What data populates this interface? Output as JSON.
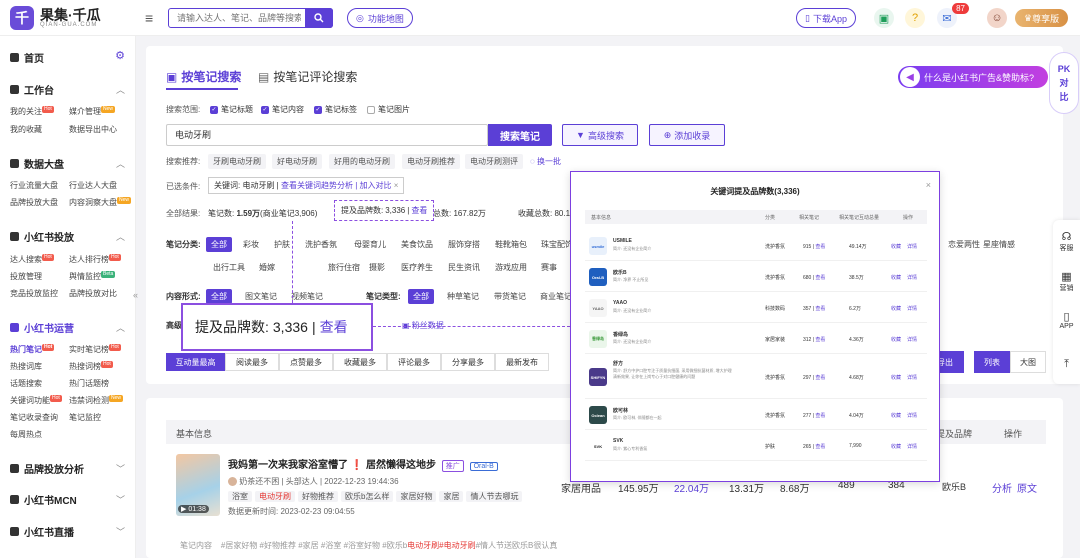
{
  "topbar": {
    "logo_char": "千",
    "logo_name": "果集·千瓜",
    "logo_sub": "QIAN-GUA.COM",
    "search_placeholder": "请输入达人、笔记、品牌等搜索",
    "func_map": "功能地图",
    "download_app": "下载App",
    "mail_count": "87",
    "vip": "尊享版"
  },
  "sidebar": {
    "home": "首页",
    "workbench": "工作台",
    "wb_items": [
      "我的关注",
      "媒介管理",
      "我的收藏",
      "数据导出中心"
    ],
    "dashboard": "数据大盘",
    "db_items": [
      "行业流量大盘",
      "行业达人大盘",
      "品牌投放大盘",
      "内容洞察大盘"
    ],
    "xhs_ad": "小红书投放",
    "ad_items": [
      "达人搜索",
      "达人排行榜",
      "投放管理",
      "舆情监控",
      "竞品投放监控",
      "品牌投放对比"
    ],
    "xhs_ops": "小红书运营",
    "ops_items": [
      "热门笔记",
      "实时笔记榜",
      "热搜词库",
      "热搜词榜",
      "话题搜索",
      "热门话题榜",
      "关键词功能",
      "违禁词检测",
      "笔记收录查询",
      "笔记监控",
      "每周热点"
    ],
    "brand_analysis": "品牌投放分析",
    "mcn": "小红书MCN",
    "live": "小红书直播",
    "tags": {
      "hot": "Hot",
      "new": "New",
      "beta": "Beta"
    }
  },
  "main": {
    "tab_active": "按笔记搜索",
    "tab_other": "按笔记评论搜索",
    "ad_banner": "什么是小红书广告&赞助标?",
    "scope_label": "搜索范围:",
    "scope": [
      {
        "label": "笔记标题",
        "on": true
      },
      {
        "label": "笔记内容",
        "on": true
      },
      {
        "label": "笔记标签",
        "on": true
      },
      {
        "label": "笔记图片",
        "on": false
      }
    ],
    "query": "电动牙刷",
    "search_btn": "搜索笔记",
    "advanced_btn": "高级搜索",
    "add_btn": "添加收录",
    "rec_label": "搜索推荐:",
    "rec": [
      "牙刷电动牙刷",
      "好电动牙刷",
      "好用的电动牙刷",
      "电动牙刷推荐",
      "电动牙刷测评"
    ],
    "refresh": "换一批",
    "cond_label": "已选条件:",
    "cond_tag": "关键词: 电动牙刷",
    "cond_link": "查看关键词趋势分析 | 加入对比",
    "result_label": "全部结果:",
    "result_prefix": "笔记数:",
    "result_count": "1.59万",
    "result_biz": "(商业笔记3,906)",
    "brand_mentions_label": "提及品牌数:",
    "brand_mentions": "3,336",
    "view": "查看",
    "likes": "点赞总数: 167.82万",
    "collects": "收藏总数: 80.11",
    "cat_label": "笔记分类:",
    "cats_row1": [
      "全部",
      "彩妆",
      "护肤",
      "洗护香氛",
      "母婴育儿",
      "美食饮品",
      "服饰穿搭",
      "鞋靴箱包",
      "珠宝配饰"
    ],
    "cats_row1_right": [
      "家居家装",
      "恋爱两性",
      "星座情感"
    ],
    "cats_row2": [
      "出行工具",
      "婚嫁",
      "摄影",
      "旅行住宿",
      "摄影",
      "医疗养生",
      "民生资讯",
      "游戏应用",
      "赛事"
    ],
    "form_label": "内容形式:",
    "forms": [
      "全部",
      "图文笔记",
      "视频笔记"
    ],
    "type_label": "笔记类型:",
    "types": [
      "全部",
      "种草笔记",
      "带货笔记",
      "商业笔记"
    ],
    "adv_label": "高级",
    "fans": "粉丝数据",
    "sort": [
      "互动量最高",
      "阅读最多",
      "点赞最多",
      "收藏最多",
      "评论最多",
      "分享最多",
      "最新发布"
    ],
    "export": "导出",
    "view_list": "列表",
    "view_grid": "大图"
  },
  "floating": {
    "pk": [
      "PK",
      "对",
      "比"
    ],
    "items": [
      "客服",
      "营销",
      "APP"
    ]
  },
  "modal": {
    "title": "关键词提及品牌数(3,336)",
    "headers": [
      "基本信息",
      "分类",
      "相关笔记",
      "相关笔记互动总量",
      "操作"
    ],
    "rows": [
      {
        "logo": "usmile",
        "color": "#e8f0fb",
        "text_color": "#2f6bd6",
        "name": "USMILE",
        "desc": "简介: 还没有企业简介",
        "cat": "洗护香氛",
        "notes": "915",
        "view": "查看",
        "total": "49.14万"
      },
      {
        "logo": "Oral-B",
        "color": "#1f5fbf",
        "text_color": "#ffffff",
        "name": "欧乐B",
        "desc": "简介: 净界 不止所见",
        "cat": "洗护香氛",
        "notes": "680",
        "view": "查看",
        "total": "38.5万"
      },
      {
        "logo": "YAAO",
        "color": "#f5f5f5",
        "text_color": "#666666",
        "name": "YAAO",
        "desc": "简介: 还没有企业简介",
        "cat": "科技数码",
        "notes": "357",
        "view": "查看",
        "total": "6.2万"
      },
      {
        "logo": "香绿岛",
        "color": "#eaf6ea",
        "text_color": "#3b9a3b",
        "name": "香绿岛",
        "desc": "简介: 还没有企业简介",
        "cat": "家居家装",
        "notes": "312",
        "view": "查看",
        "total": "4.36万"
      },
      {
        "logo": "SHIFYN",
        "color": "#4a3a8a",
        "text_color": "#ffffff",
        "name": "舒方",
        "desc": "简介: 舒方中护口腔专注于质量抗细菌, 采用微细抗菌材质, 增大护理清新效果, 让你在上岗专心于对口腔健康的问题",
        "cat": "洗护香氛",
        "notes": "297",
        "view": "查看",
        "total": "4.68万"
      },
      {
        "logo": "Oclean",
        "color": "#2d4a4a",
        "text_color": "#ffffff",
        "name": "欧可林",
        "desc": "简介: 欧可林, 伴随都在一起",
        "cat": "洗护香氛",
        "notes": "277",
        "view": "查看",
        "total": "4.04万"
      },
      {
        "logo": "SVK",
        "color": "#ffffff",
        "text_color": "#222222",
        "name": "SVK",
        "desc": "简介: 紫心专利香氛",
        "cat": "护肤",
        "notes": "265",
        "view": "查看",
        "total": "7,990"
      }
    ],
    "act1": "收藏",
    "act2": "详情",
    "close": "×"
  },
  "callout": {
    "label": "提及品牌数:",
    "value": "3,336",
    "sep": "|",
    "link": "查看"
  },
  "table": {
    "h_basic": "基本信息",
    "h_brand": "提及品牌",
    "h_op": "操作",
    "note": {
      "title": "我妈第一次来我家浴室懵了",
      "title_suffix": "居然懒得这地步",
      "badge1": "推广",
      "badge2": "Oral-B",
      "author": "奶茶还不困",
      "author_type": "头部达人",
      "time": "2022-12-23 19:44:36",
      "tags": [
        "浴室",
        "电动牙刷",
        "好物推荐",
        "欧乐b怎么样",
        "家居好物",
        "家居",
        "情人节去哪玩"
      ],
      "updated": "数据更新时间:  2023-02-23 09:04:55",
      "duration": "01:38",
      "stats": [
        "家居用品",
        "145.95万",
        "22.04万",
        "13.31万",
        "8.68万",
        "489",
        "384"
      ],
      "brand": "欧乐B",
      "op1": "分析",
      "op2": "原文",
      "footer_label": "笔记内容",
      "footer_text": "#居家好物 #好物推荐 #家居 #浴室 #浴室好物 #欧乐b",
      "footer_hl": "电动牙刷",
      "footer_tail": "#情人节送欧乐B很认真"
    }
  }
}
